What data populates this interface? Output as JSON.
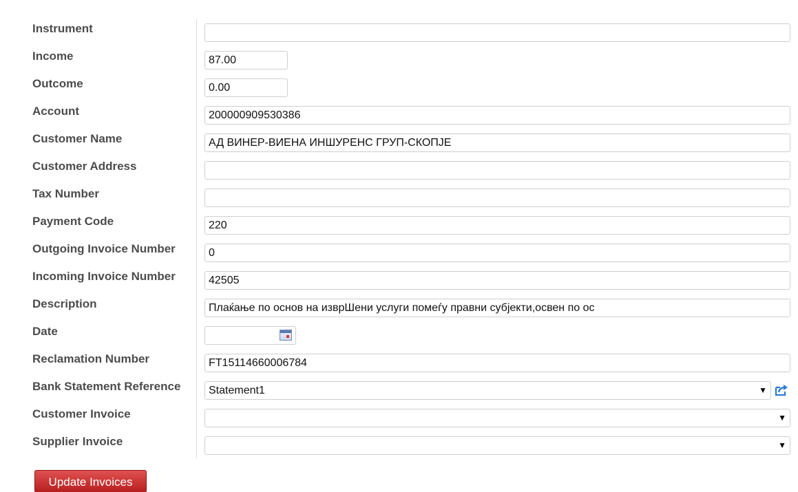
{
  "form": {
    "instrument": {
      "label": "Instrument",
      "value": ""
    },
    "income": {
      "label": "Income",
      "value": "87.00"
    },
    "outcome": {
      "label": "Outcome",
      "value": "0.00"
    },
    "account": {
      "label": "Account",
      "value": "200000909530386"
    },
    "customer_name": {
      "label": "Customer Name",
      "value": "АД ВИНЕР-ВИЕНА ИНШУРЕНС ГРУП-СКОПЈЕ"
    },
    "customer_address": {
      "label": "Customer Address",
      "value": ""
    },
    "tax_number": {
      "label": "Tax Number",
      "value": ""
    },
    "payment_code": {
      "label": "Payment Code",
      "value": "220"
    },
    "outgoing_invoice_number": {
      "label": "Outgoing Invoice Number",
      "value": "0"
    },
    "incoming_invoice_number": {
      "label": "Incoming Invoice Number",
      "value": "42505"
    },
    "description": {
      "label": "Description",
      "value": "Плаќање по основ на изврШени услуги помеѓу правни субјекти,освен по ос"
    },
    "date": {
      "label": "Date",
      "value": ""
    },
    "reclamation_number": {
      "label": "Reclamation Number",
      "value": "FT15114660006784"
    },
    "bank_statement_reference": {
      "label": "Bank Statement Reference",
      "value": "Statement1"
    },
    "customer_invoice": {
      "label": "Customer Invoice",
      "value": ""
    },
    "supplier_invoice": {
      "label": "Supplier Invoice",
      "value": ""
    }
  },
  "actions": {
    "update_invoices_label": "Update Invoices"
  },
  "icons": {
    "calendar": "calendar-icon",
    "select_caret": "caret-down-icon",
    "external_link": "external-link-icon"
  },
  "colors": {
    "primary_button": "#c62d2d",
    "link_icon": "#2a7bd6",
    "label_text": "#4c4c4c"
  }
}
